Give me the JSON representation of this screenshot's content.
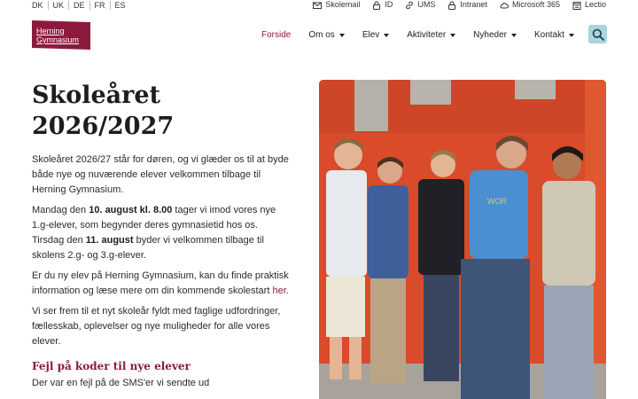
{
  "languages": [
    "DK",
    "UK",
    "DE",
    "FR",
    "ES"
  ],
  "quick_links": [
    {
      "label": "Skolemail",
      "icon": "mail-icon"
    },
    {
      "label": "ID",
      "icon": "lock-icon"
    },
    {
      "label": "UMS",
      "icon": "link-icon"
    },
    {
      "label": "Intranet",
      "icon": "lock-icon"
    },
    {
      "label": "Microsoft 365",
      "icon": "cloud-icon"
    },
    {
      "label": "Lectio",
      "icon": "calendar-icon"
    }
  ],
  "logo": {
    "line1": "Herning",
    "line2": "Gymnasium"
  },
  "nav": [
    {
      "label": "Forside"
    },
    {
      "label": "Om os"
    },
    {
      "label": "Elev"
    },
    {
      "label": "Aktiviteter"
    },
    {
      "label": "Nyheder"
    },
    {
      "label": "Kontakt"
    }
  ],
  "main": {
    "title_line1": "Skoleåret",
    "title_line2": "2026/2027",
    "p1": "Skoleåret 2026/27 står for døren, og vi glæder os til at byde både nye og nuværende elever velkommen tilbage til Herning Gymnasium.",
    "p2_a": "Mandag den ",
    "p2_b": "10. august kl. 8.00",
    "p2_c": " tager vi imod vores nye 1.g-elever, som begynder deres gymnasietid hos os. Tirsdag den ",
    "p2_d": "11. august",
    "p2_e": " byder vi velkommen tilbage til skolens 2.g- og 3.g-elever.",
    "p3_a": "Er du ny elev på Herning Gymnasium, kan du finde praktisk information og læse mere om din kommende skolestart ",
    "p3_link": "her",
    "p3_b": ".",
    "p4": "Vi ser frem til et nyt skoleår fyldt med faglige udfordringer, fællesskab, oplevelser og nye muligheder for alle vores elever.",
    "subheading": "Fejl på koder til nye elever",
    "p5": "Der var en fejl på de SMS'er vi sendte ud"
  },
  "colors": {
    "brand": "#8c1a3c",
    "search_bg": "#a9d5dc",
    "wall": "#d94b2b"
  }
}
